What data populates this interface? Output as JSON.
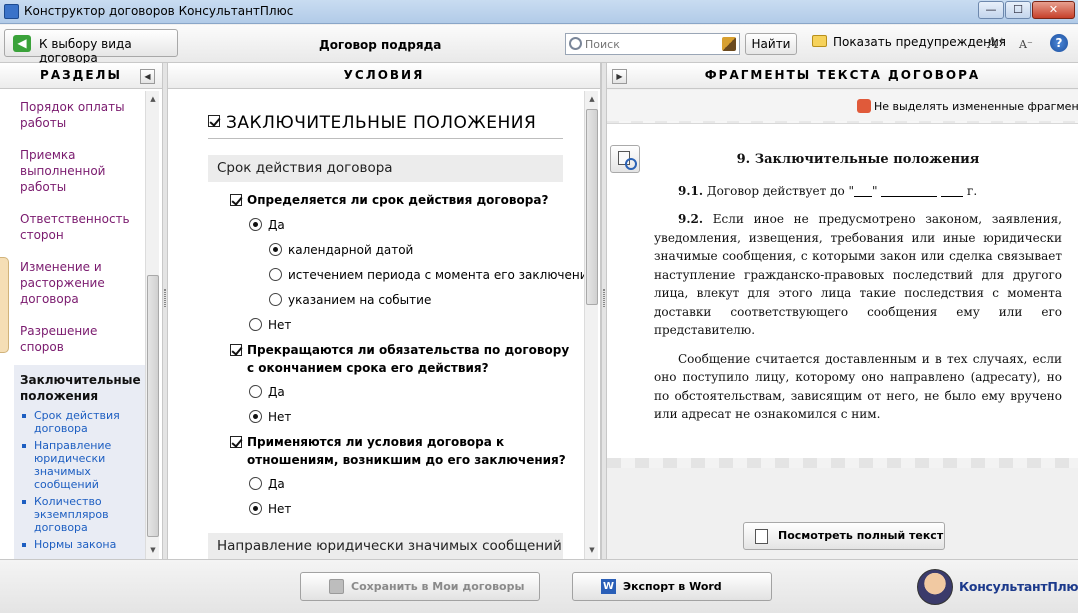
{
  "window": {
    "title": "Конструктор договоров КонсультантПлюс",
    "min_glyph": "—",
    "max_glyph": "☐",
    "close_glyph": "✕"
  },
  "toolbar": {
    "back_label": "К выбору вида договора",
    "back_glyph": "◀",
    "document_title": "Договор подряда",
    "search_placeholder": "Поиск",
    "find_label": "Найти",
    "warnings_label": "Показать предупреждения",
    "font_increase": "A⁺",
    "font_decrease": "A⁻",
    "help_glyph": "?"
  },
  "sections_panel": {
    "title": "РАЗДЕЛЫ",
    "collapse_glyph": "◀",
    "items": [
      {
        "label": "Порядок оплаты работы"
      },
      {
        "label": "Приемка выполненной работы"
      },
      {
        "label": "Ответственность сторон"
      },
      {
        "label": "Изменение и расторжение договора"
      },
      {
        "label": "Разрешение споров"
      }
    ],
    "active": {
      "label": "Заключительные положения",
      "subitems": [
        {
          "label": "Срок действия договора"
        },
        {
          "label": "Направление юридически значимых сообщений"
        },
        {
          "label": "Количество экземпляров договора"
        },
        {
          "label": "Нормы закона"
        }
      ]
    }
  },
  "conditions_panel": {
    "title": "УСЛОВИЯ",
    "section_heading": "ЗАКЛЮЧИТЕЛЬНЫЕ ПОЛОЖЕНИЯ",
    "groups": [
      {
        "label": "Срок действия договора"
      },
      {
        "label": "Направление юридически значимых сообщений"
      }
    ],
    "questions": [
      {
        "text": "Определяется ли срок действия договора?",
        "checked": true,
        "options": [
          {
            "label": "Да",
            "selected": true
          },
          {
            "label": "календарной датой",
            "selected": true
          },
          {
            "label": "истечением периода с момента его заключения",
            "selected": false
          },
          {
            "label": "указанием на событие",
            "selected": false
          },
          {
            "label": "Нет",
            "selected": false
          }
        ]
      },
      {
        "text": "Прекращаются ли обязательства по договору с окончанием срока его действия?",
        "checked": true,
        "options": [
          {
            "label": "Да",
            "selected": false
          },
          {
            "label": "Нет",
            "selected": true
          }
        ]
      },
      {
        "text": "Применяются ли условия договора к отношениям, возникшим до его заключения?",
        "checked": true,
        "options": [
          {
            "label": "Да",
            "selected": false
          },
          {
            "label": "Нет",
            "selected": true
          }
        ]
      }
    ]
  },
  "fragments_panel": {
    "title": "ФРАГМЕНТЫ ТЕКСТА ДОГОВОРА",
    "expand_glyph": "▶",
    "no_highlight_label": "Не выделять измененные фрагменты",
    "heading": "9. Заключительные положения",
    "p1_num": "9.1.",
    "p1_text": "Договор действует до \"",
    "p1_q2": "\"",
    "p1_end": "г.",
    "p2_num": "9.2.",
    "p2_text": "Если иное не предусмотрено законом, заявления, уведомления, извещения, требования или иные юридически значимые сообщения, с которыми закон или сделка связывает наступление гражданско-правовых последствий для другого лица, влекут для этого лица такие последствия с момента доставки соответствующего сообщения ему или его представителю.",
    "p3_text": "Сообщение считается доставленным и в тех случаях, если оно поступило лицу, которому оно направлено (адресату), но по обстоятельствам, зависящим от него, не было ему вручено или адресат не ознакомился с ним.",
    "full_text_button": "Посмотреть полный текст"
  },
  "bottom_bar": {
    "save_label": "Сохранить в Мои договоры",
    "export_label": "Экспорт в Word",
    "export_icon_letter": "W",
    "logo_text": "КонсультантПлюс"
  }
}
